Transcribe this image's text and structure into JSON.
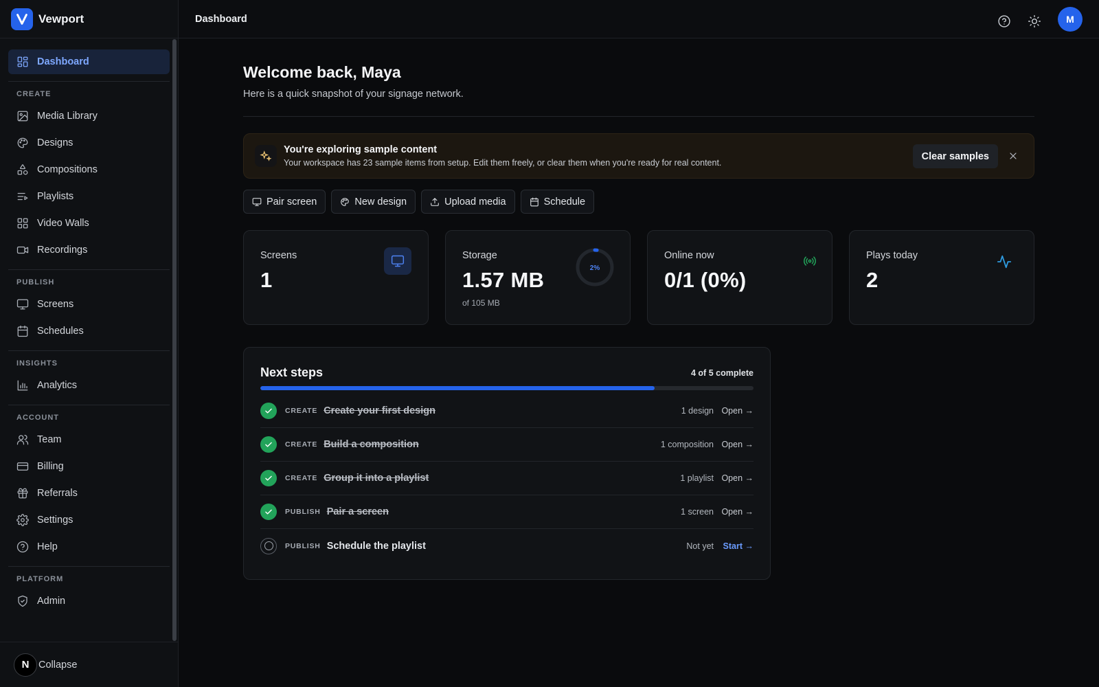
{
  "brand": {
    "name": "Vewport"
  },
  "sidebar": {
    "dashboard": "Dashboard",
    "sections": {
      "create": "CREATE",
      "publish": "PUBLISH",
      "insights": "INSIGHTS",
      "account": "ACCOUNT",
      "platform": "PLATFORM"
    },
    "items": {
      "media_library": "Media Library",
      "designs": "Designs",
      "compositions": "Compositions",
      "playlists": "Playlists",
      "video_walls": "Video Walls",
      "recordings": "Recordings",
      "screens": "Screens",
      "schedules": "Schedules",
      "analytics": "Analytics",
      "team": "Team",
      "billing": "Billing",
      "referrals": "Referrals",
      "settings": "Settings",
      "help": "Help",
      "admin": "Admin"
    },
    "footer": {
      "badge": "N",
      "collapse": "Collapse"
    }
  },
  "topbar": {
    "title": "Dashboard",
    "avatar": "M"
  },
  "main": {
    "welcome": "Welcome back, Maya",
    "subtitle": "Here is a quick snapshot of your signage network.",
    "banner": {
      "title": "You're exploring sample content",
      "description": "Your workspace has 23 sample items from setup. Edit them freely, or clear them when you're ready for real content.",
      "button": "Clear samples"
    },
    "actions": {
      "pair_screen": "Pair screen",
      "new_design": "New design",
      "upload_media": "Upload media",
      "schedule": "Schedule"
    },
    "stats": {
      "screens": {
        "label": "Screens",
        "value": "1"
      },
      "storage": {
        "label": "Storage",
        "value": "1.57 MB",
        "sub": "of 105 MB",
        "percent_label": "2%",
        "percent": 0.02
      },
      "online": {
        "label": "Online now",
        "value": "0/1 (0%)"
      },
      "plays": {
        "label": "Plays today",
        "value": "2"
      }
    },
    "steps": {
      "title": "Next steps",
      "progress_label": "4 of 5 complete",
      "progress": 0.8,
      "rows": [
        {
          "category": "CREATE",
          "name": "Create your first design",
          "meta": "1 design",
          "link": "Open →"
        },
        {
          "category": "CREATE",
          "name": "Build a composition",
          "meta": "1 composition",
          "link": "Open →"
        },
        {
          "category": "CREATE",
          "name": "Group it into a playlist",
          "meta": "1 playlist",
          "link": "Open →"
        },
        {
          "category": "PUBLISH",
          "name": "Pair a screen",
          "meta": "1 screen",
          "link": "Open →"
        },
        {
          "category": "PUBLISH",
          "name": "Schedule the playlist",
          "meta": "Not yet",
          "link": "Start →"
        }
      ]
    }
  },
  "colors": {
    "accent": "#2563eb",
    "success": "#22a35a",
    "warning_bg": "#1c1710"
  },
  "icons": {
    "nav": [
      "dashboard-icon",
      "image-icon",
      "palette-icon",
      "shapes-icon",
      "list-music-icon",
      "grid-icon",
      "video-icon",
      "monitor-icon",
      "calendar-icon",
      "bar-chart-icon",
      "users-icon",
      "credit-card-icon",
      "gift-icon",
      "gear-icon",
      "help-circle-icon",
      "shield-icon"
    ]
  }
}
